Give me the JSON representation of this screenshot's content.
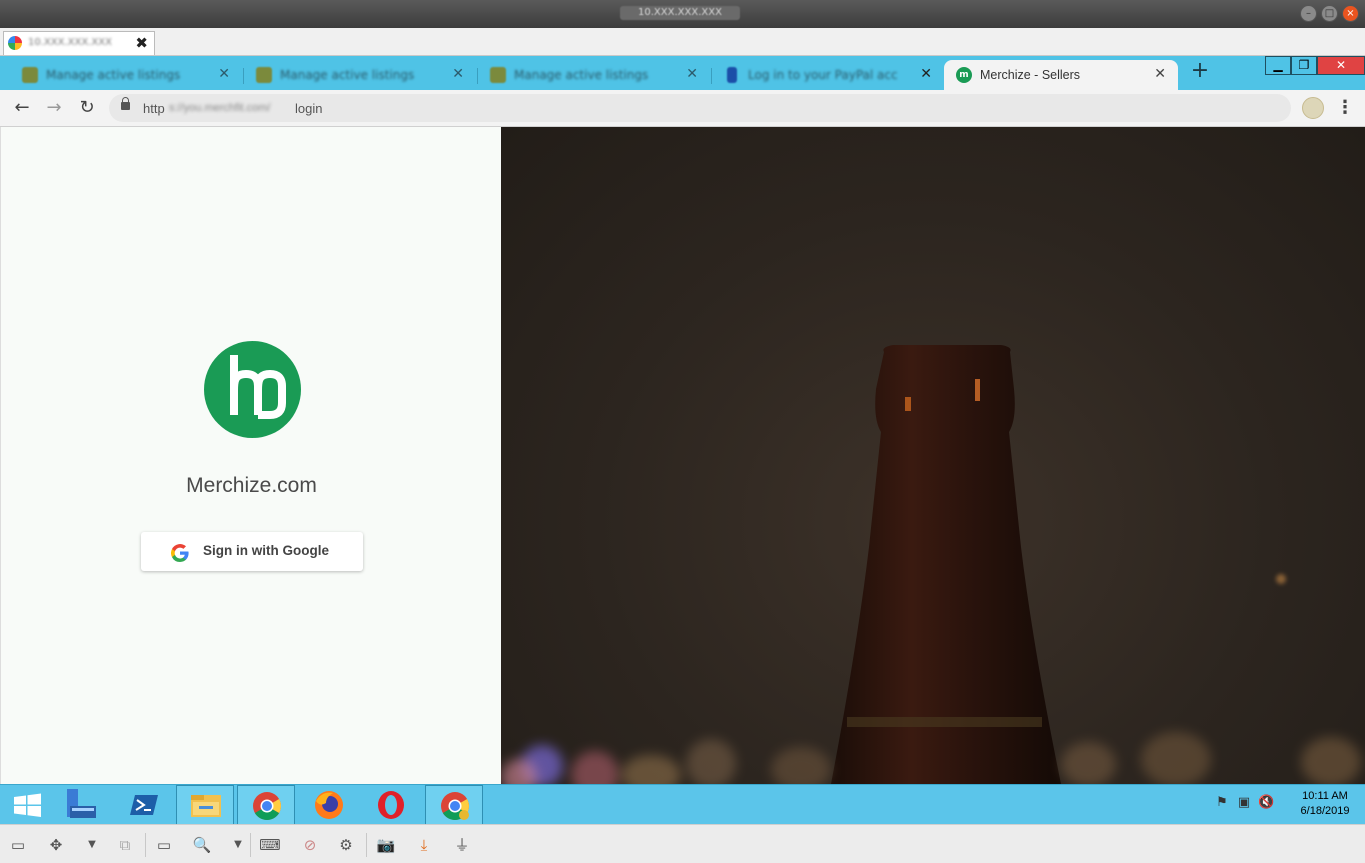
{
  "remote_window": {
    "title": "10.XXX.XXX.XXX",
    "session_tab": {
      "label": "10.XXX.XXX.XXX"
    }
  },
  "browser": {
    "tabs": [
      {
        "title": "Manage active listings",
        "favicon": "shop-icon",
        "active": false
      },
      {
        "title": "Manage active listings",
        "favicon": "shop-icon",
        "active": false
      },
      {
        "title": "Manage active listings",
        "favicon": "shop-icon",
        "active": false
      },
      {
        "title": "Log in to your PayPal account",
        "favicon": "paypal-icon",
        "active": false
      },
      {
        "title": "Merchize - Sellers",
        "favicon": "merchize-icon",
        "active": true
      }
    ],
    "address": {
      "prefix": "http",
      "hidden_part": "s://you.merchfit.com/",
      "suffix": "login"
    }
  },
  "page": {
    "brand_name": "Merchize.com",
    "signin_button": "Sign in with Google",
    "brand_color": "#1a9b55"
  },
  "taskbar": {
    "apps": [
      "start-icon",
      "server-manager-icon",
      "powershell-icon",
      "file-explorer-icon",
      "chrome-icon",
      "firefox-icon",
      "opera-icon",
      "chrome-canary-icon"
    ],
    "clock_time": "10:11 AM",
    "clock_date": "6/18/2019"
  }
}
